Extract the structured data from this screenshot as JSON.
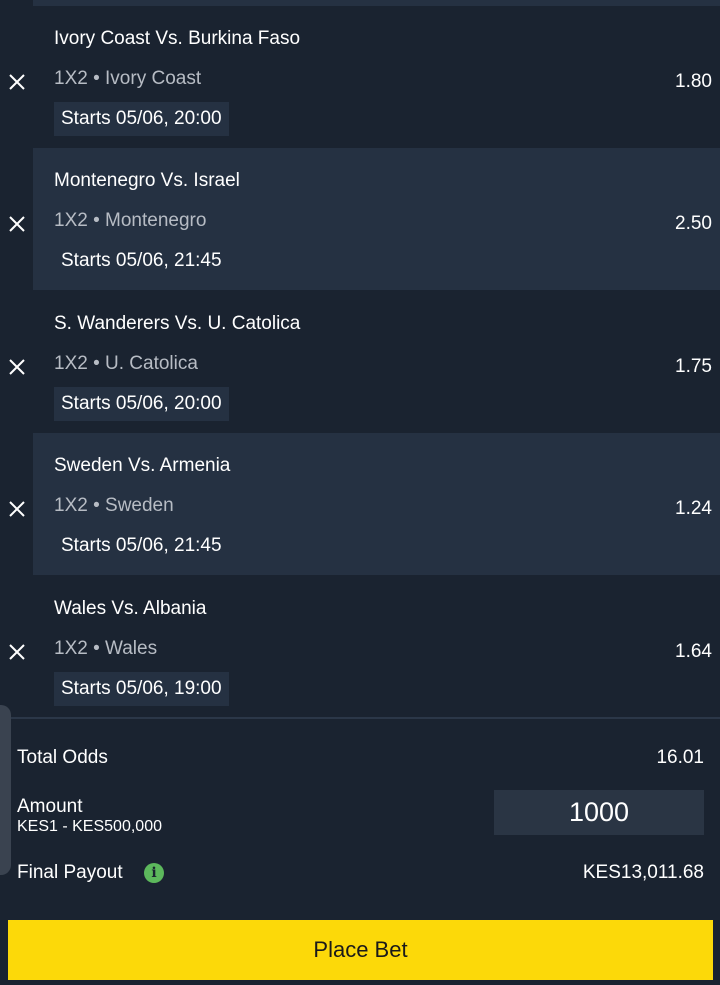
{
  "bets": [
    {
      "match": "Ivory Coast Vs. Burkina Faso",
      "market": "1X2 • Ivory Coast",
      "odds": "1.80",
      "starts": "Starts 05/06, 20:00"
    },
    {
      "match": "Montenegro Vs. Israel",
      "market": "1X2 • Montenegro",
      "odds": "2.50",
      "starts": "Starts 05/06, 21:45"
    },
    {
      "match": "S. Wanderers Vs. U. Catolica",
      "market": "1X2 • U. Catolica",
      "odds": "1.75",
      "starts": "Starts 05/06, 20:00"
    },
    {
      "match": "Sweden Vs. Armenia",
      "market": "1X2 • Sweden",
      "odds": "1.24",
      "starts": "Starts 05/06, 21:45"
    },
    {
      "match": "Wales Vs. Albania",
      "market": "1X2 • Wales",
      "odds": "1.64",
      "starts": "Starts 05/06, 19:00"
    }
  ],
  "summary": {
    "total_odds_label": "Total Odds",
    "total_odds_value": "16.01",
    "amount_label": "Amount",
    "amount_range": "KES1 - KES500,000",
    "amount_value": "1000",
    "payout_label": "Final Payout",
    "payout_value": "KES13,011.68"
  },
  "place_bet_label": "Place Bet",
  "icons": {
    "remove": "close-icon",
    "info": "info-icon"
  },
  "colors": {
    "background": "#1a2330",
    "panel": "#253142",
    "accent": "#fcd909",
    "info": "#5cb85c"
  }
}
